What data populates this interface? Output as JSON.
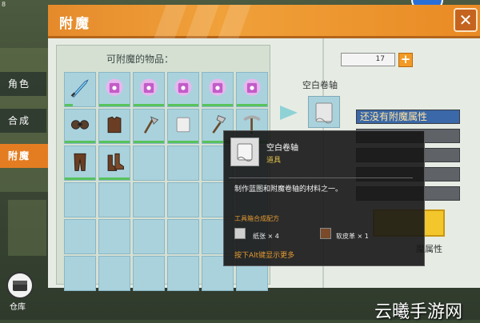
{
  "window": {
    "corner_number": "8"
  },
  "header": {
    "title": "附魔",
    "close_symbol": "✕"
  },
  "sidebar": {
    "items": [
      {
        "label": "角色",
        "active": false
      },
      {
        "label": "合成",
        "active": false
      },
      {
        "label": "附魔",
        "active": true
      }
    ],
    "warehouse_label": "仓库"
  },
  "items_panel": {
    "title": "可附魔的物品：",
    "rows": 6,
    "columns": 6,
    "items": [
      {
        "icon": "diamond-sword-icon",
        "durability_fraction": 0.25
      },
      {
        "icon": "enchanted-book-icon"
      },
      {
        "icon": "enchanted-book-icon"
      },
      {
        "icon": "enchanted-book-icon"
      },
      {
        "icon": "enchanted-book-icon"
      },
      {
        "icon": "enchanted-book-icon"
      },
      {
        "icon": "goggles-icon"
      },
      {
        "icon": "leather-armor-icon"
      },
      {
        "icon": "axe-icon"
      },
      {
        "icon": "blank-scroll-icon"
      },
      {
        "icon": "shovel-icon"
      },
      {
        "icon": "pickaxe-icon"
      },
      {
        "icon": "leather-pants-icon"
      },
      {
        "icon": "leather-boots-icon"
      }
    ]
  },
  "enchant_panel": {
    "star_count": "17",
    "plus_symbol": "+",
    "item_name": "空白卷轴",
    "enchant_status": "还没有附魔属性",
    "enchant_button_label": "魔属性"
  },
  "tooltip": {
    "name": "空白卷轴",
    "type": "道具",
    "description": "制作蓝图和附魔卷轴的材料之一。",
    "recipe_title": "工具箱合成配方",
    "materials": [
      {
        "icon": "paper-icon",
        "label": "纸张 × 4"
      },
      {
        "icon": "leather-icon",
        "label": "软皮革 × 1"
      }
    ],
    "hint": "按下Alt键显示更多"
  },
  "watermark": "云曦手游网",
  "colors": {
    "accent": "#e47d22",
    "slot": "#a9d2dd",
    "tooltip_bg": "#161616"
  }
}
